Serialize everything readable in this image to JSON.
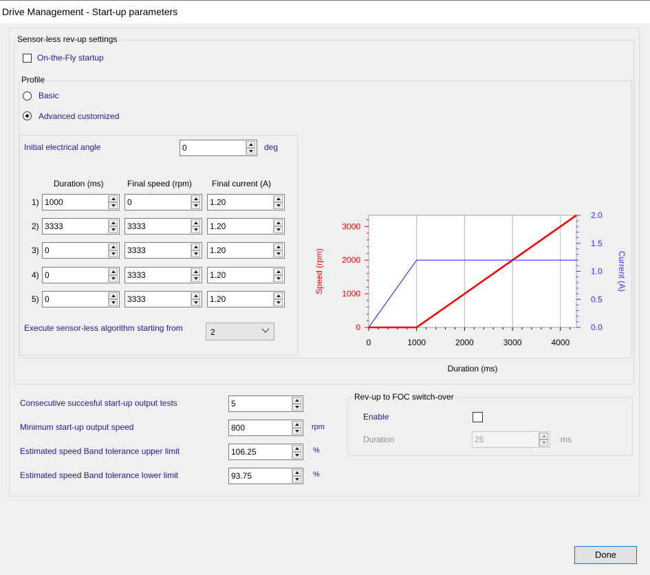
{
  "window": {
    "title": "Drive Management - Start-up parameters"
  },
  "revup": {
    "group_label": "Sensor-less rev-up settings",
    "on_the_fly": {
      "label": "On-the-Fly startup",
      "checked": false
    },
    "profile": {
      "label": "Profile",
      "basic": {
        "label": "Basic",
        "selected": false
      },
      "advanced": {
        "label": "Advanced customized",
        "selected": true
      }
    },
    "initial_angle": {
      "label": "Initial electrical angle",
      "value": "0",
      "unit": "deg"
    },
    "columns": {
      "duration": "Duration (ms)",
      "speed": "Final speed (rpm)",
      "current": "Final current (A)"
    },
    "rows": [
      {
        "index": "1)",
        "duration": "1000",
        "speed": "0",
        "current": "1.20"
      },
      {
        "index": "2)",
        "duration": "3333",
        "speed": "3333",
        "current": "1.20"
      },
      {
        "index": "3)",
        "duration": "0",
        "speed": "3333",
        "current": "1.20"
      },
      {
        "index": "4)",
        "duration": "0",
        "speed": "3333",
        "current": "1.20"
      },
      {
        "index": "5)",
        "duration": "0",
        "speed": "3333",
        "current": "1.20"
      }
    ],
    "execute": {
      "label": "Execute sensor-less algorithm starting from",
      "value": "2"
    }
  },
  "chart_data": {
    "type": "line",
    "title": "",
    "xlabel": "Duration (ms)",
    "ylabel": "Speed (rpm)",
    "y2label": "Current (A)",
    "xlim": [
      0,
      4333
    ],
    "ylim": [
      0,
      3333
    ],
    "y2lim": [
      0,
      2.0
    ],
    "x_ticks": [
      "0",
      "1000",
      "2000",
      "3000",
      "4000"
    ],
    "y_ticks": [
      "0",
      "1000",
      "2000",
      "3000"
    ],
    "y2_ticks": [
      "0.0",
      "0.5",
      "1.0",
      "1.5",
      "2.0"
    ],
    "grid": true,
    "series": [
      {
        "axis": "left",
        "color": "#ff0000",
        "x": [
          0,
          1000,
          4333
        ],
        "y": [
          0,
          0,
          3333
        ]
      },
      {
        "axis": "right",
        "color": "#3333ff",
        "x": [
          0,
          1000,
          4333
        ],
        "y": [
          0,
          1.2,
          1.2
        ]
      }
    ],
    "colors": {
      "speed": "#ff0000",
      "current": "#3333ff"
    }
  },
  "output": {
    "consecutive": {
      "label": "Consecutive succesful start-up output tests",
      "value": "5"
    },
    "min_speed": {
      "label": "Minimum start-up output speed",
      "value": "800",
      "unit": "rpm"
    },
    "upper": {
      "label": "Estimated speed Band tolerance upper limit",
      "value": "106.25",
      "unit": "%"
    },
    "lower": {
      "label": "Estimated speed Band tolerance lower limit",
      "value": "93.75",
      "unit": "%"
    }
  },
  "foc": {
    "group_label": "Rev-up to FOC switch-over",
    "enable": {
      "label": "Enable",
      "checked": false
    },
    "duration": {
      "label": "Duration",
      "value": "25",
      "unit": "ms"
    }
  },
  "buttons": {
    "done": "Done"
  }
}
